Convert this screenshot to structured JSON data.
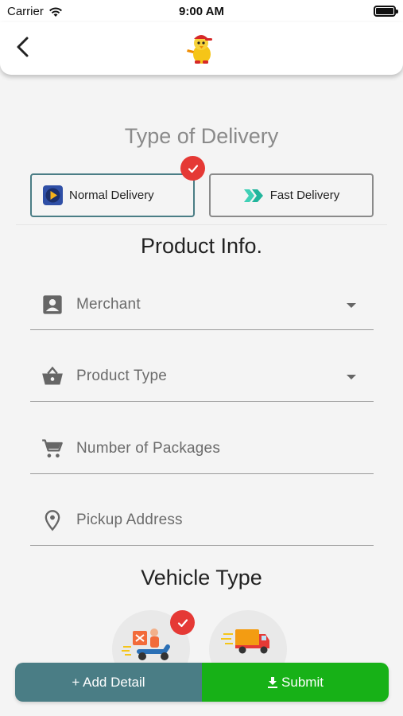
{
  "status_bar": {
    "carrier": "Carrier",
    "time": "9:00 AM"
  },
  "header": {
    "back_icon": "chevron-left-icon",
    "logo_icon": "mascot-logo-icon"
  },
  "delivery": {
    "title": "Type of Delivery",
    "options": [
      {
        "label": "Normal Delivery",
        "icon": "play-icon",
        "selected": true
      },
      {
        "label": "Fast Delivery",
        "icon": "double-chevron-icon",
        "selected": false
      }
    ]
  },
  "product": {
    "title": "Product Info.",
    "fields": [
      {
        "label": "Merchant",
        "icon": "account-box-icon",
        "dropdown": true
      },
      {
        "label": "Product Type",
        "icon": "basket-icon",
        "dropdown": true
      },
      {
        "label": "Number of Packages",
        "icon": "cart-icon",
        "dropdown": false
      },
      {
        "label": "Pickup Address",
        "icon": "location-pin-icon",
        "dropdown": false
      }
    ]
  },
  "vehicle": {
    "title": "Vehicle Type",
    "options": [
      {
        "name": "scooter-icon",
        "selected": true
      },
      {
        "name": "truck-icon",
        "selected": false
      }
    ]
  },
  "actions": {
    "add_detail": "+ Add Detail",
    "submit": "Submit"
  },
  "colors": {
    "teal": "#4a7d85",
    "green": "#17b117",
    "red_badge": "#e53935"
  }
}
